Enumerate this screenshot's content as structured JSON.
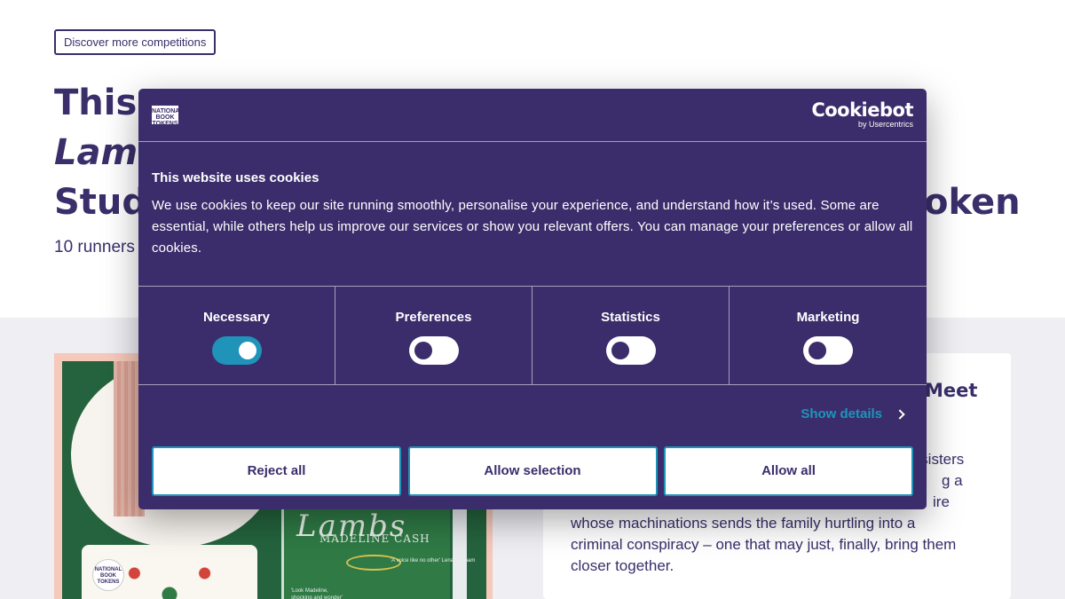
{
  "page": {
    "discover_button": "Discover more competitions",
    "headline": {
      "line1": "This",
      "line2": "Lam",
      "line3_left": "Stud",
      "line3_right": "oken"
    },
    "subline": "10 runners",
    "card": {
      "heading": "Meet",
      "body_fragments": [
        "n sisters",
        "g a",
        "ire",
        "whose machinations sends the family hurtling into a",
        "criminal conspiracy – one that may just, finally, bring them",
        "closer together."
      ]
    },
    "book_art": {
      "title": "Lambs",
      "author": "MADELINE CASH",
      "quote1": "'A voice like no other' Lena Dunham",
      "quote2": "'Look Madeline, shocking and wonder'",
      "card_logo": "NATIONAL BOOK TOKENS"
    }
  },
  "cookie_dialog": {
    "logo_left": "NATIONAL BOOK TOKENS",
    "brand": "Cookiebot",
    "brand_sub": "by Usercentrics",
    "title": "This website uses cookies",
    "text": "We use cookies to keep our site running smoothly, personalise your experience, and understand how it’s used. Some are essential, while others help us improve our services or show you relevant offers. You can manage your preferences or allow all cookies.",
    "categories": [
      {
        "label": "Necessary",
        "enabled": true
      },
      {
        "label": "Preferences",
        "enabled": false
      },
      {
        "label": "Statistics",
        "enabled": false
      },
      {
        "label": "Marketing",
        "enabled": false
      }
    ],
    "show_details": "Show details",
    "buttons": {
      "reject": "Reject all",
      "selection": "Allow selection",
      "allow": "Allow all"
    },
    "colors": {
      "dialog_bg": "#3b2d6b",
      "accent": "#1f93b8",
      "link": "#1b95bd"
    }
  }
}
